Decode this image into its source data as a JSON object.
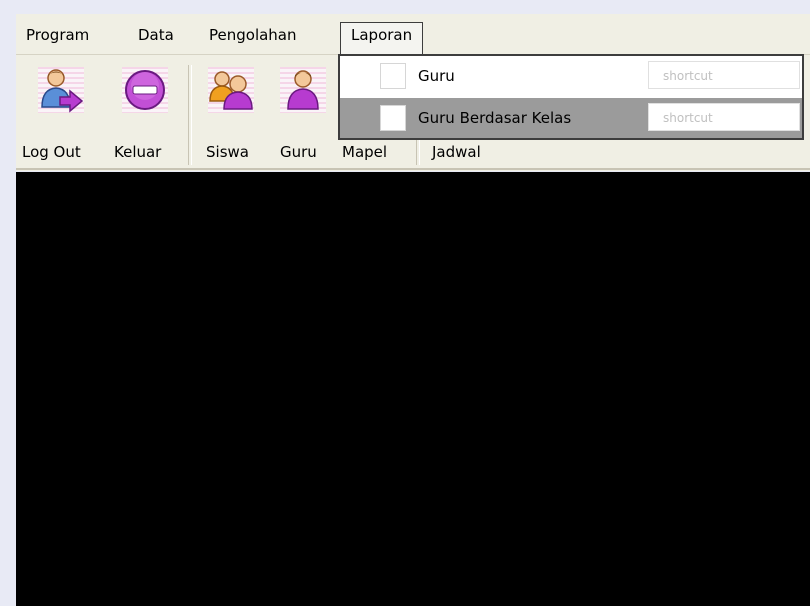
{
  "menubar": {
    "items": [
      {
        "label": "Program"
      },
      {
        "label": "Data"
      },
      {
        "label": "Pengolahan"
      },
      {
        "label": "Laporan"
      }
    ]
  },
  "toolbar": {
    "buttons": [
      {
        "label": "Log Out",
        "icon": "logout-icon"
      },
      {
        "label": "Keluar",
        "icon": "exit-icon"
      },
      {
        "label": "Siswa",
        "icon": "users-icon"
      },
      {
        "label": "Guru",
        "icon": "user-icon"
      },
      {
        "label": "Mapel",
        "icon": "book-icon"
      },
      {
        "label": "Jadwal",
        "icon": "calendar-icon"
      }
    ]
  },
  "dropdown": {
    "items": [
      {
        "label": "Guru",
        "shortcut": "shortcut",
        "highlighted": false
      },
      {
        "label": "Guru Berdasar Kelas",
        "shortcut": "shortcut",
        "highlighted": true
      }
    ]
  },
  "colors": {
    "workspace": "#000000",
    "menubar": "#f0efe4",
    "highlight": "#9b9b9b",
    "icon_purple": "#b73bd0",
    "icon_orange": "#f0a020"
  }
}
